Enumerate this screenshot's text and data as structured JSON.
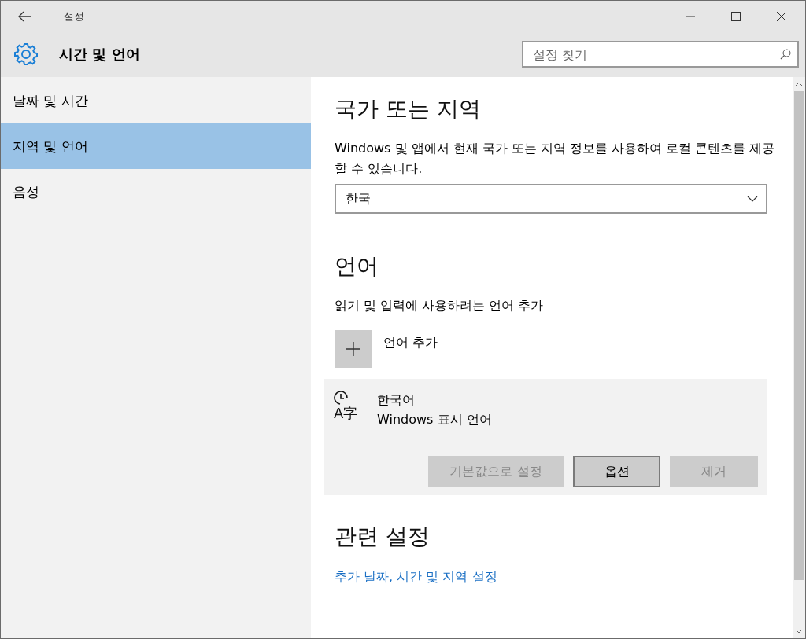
{
  "window": {
    "title": "설정"
  },
  "header": {
    "title": "시간 및 언어",
    "search": {
      "placeholder": "설정 찾기"
    }
  },
  "sidebar": {
    "items": [
      {
        "label": "날짜 및 시간",
        "selected": false
      },
      {
        "label": "지역 및 언어",
        "selected": true
      },
      {
        "label": "음성",
        "selected": false
      }
    ]
  },
  "region": {
    "heading": "국가 또는 지역",
    "description": "Windows 및 앱에서 현재 국가 또는 지역 정보를 사용하여 로컬 콘텐츠를 제공할 수 있습니다.",
    "dropdown": "한국"
  },
  "language": {
    "heading": "언어",
    "description": "읽기 및 입력에 사용하려는 언어 추가",
    "add_label": "언어 추가",
    "items": [
      {
        "icon_text": "A字",
        "name": "한국어",
        "detail": "Windows 표시 언어",
        "buttons": [
          {
            "label": "기본값으로 설정",
            "disabled": true
          },
          {
            "label": "옵션",
            "disabled": false
          },
          {
            "label": "제거",
            "disabled": true
          }
        ]
      }
    ]
  },
  "related": {
    "heading": "관련 설정",
    "link": "추가 날짜, 시간 및 지역 설정"
  }
}
